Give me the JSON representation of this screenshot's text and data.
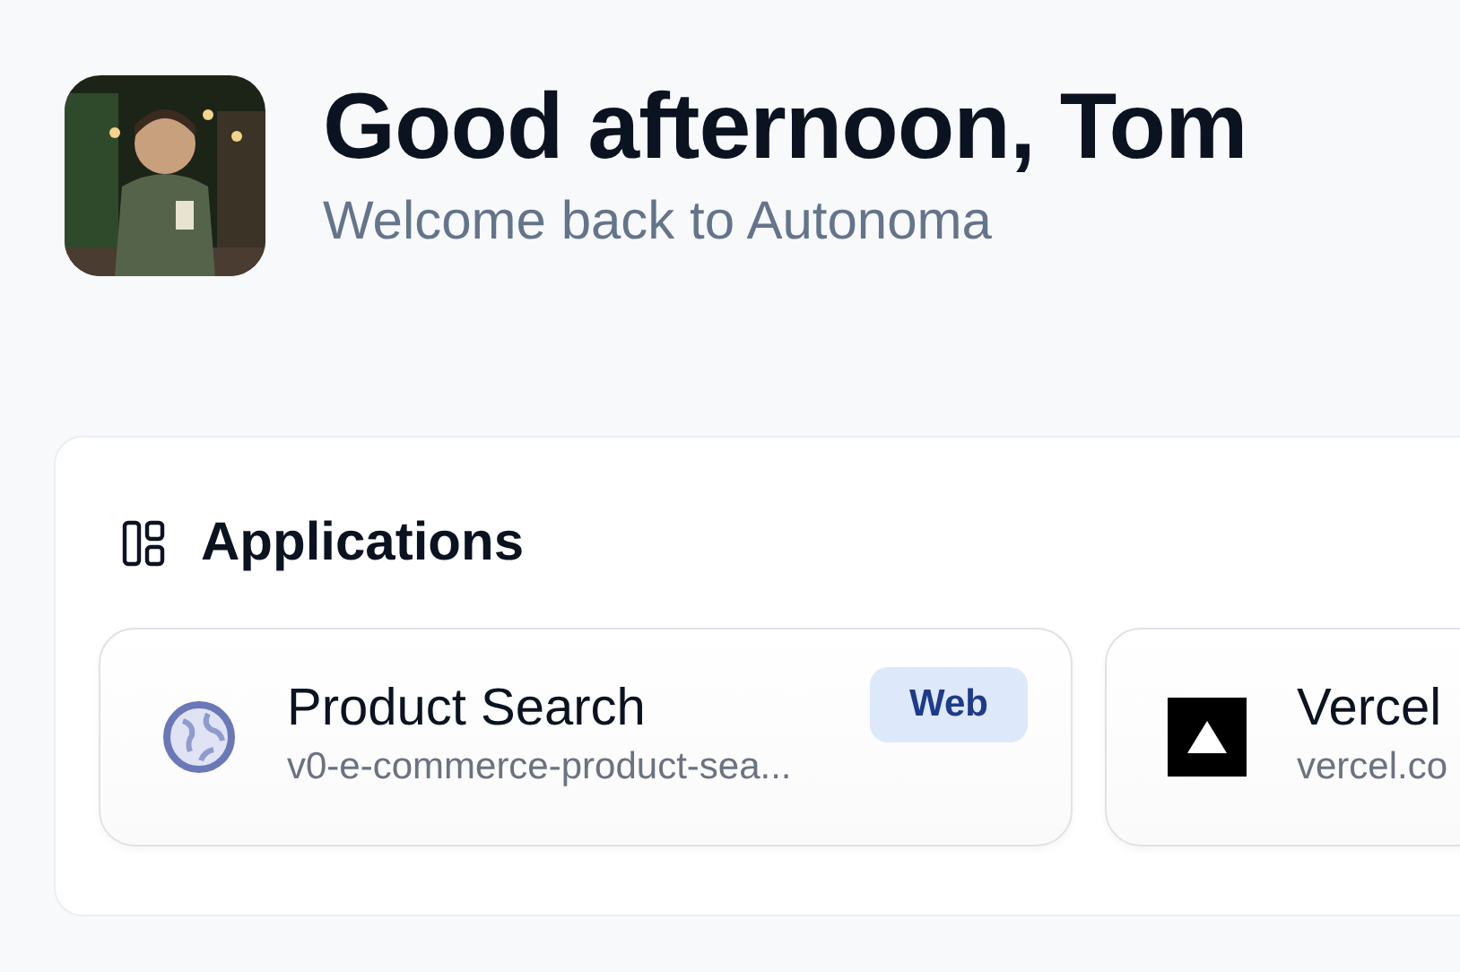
{
  "greeting": {
    "title": "Good afternoon, Tom",
    "subtitle": "Welcome back to Autonoma"
  },
  "applications": {
    "title": "Applications",
    "items": [
      {
        "name": "Product Search",
        "url": "v0-e-commerce-product-sea...",
        "badge": "Web",
        "kind": "globe"
      },
      {
        "name": "Vercel",
        "url": "vercel.co",
        "kind": "triangle"
      }
    ]
  }
}
